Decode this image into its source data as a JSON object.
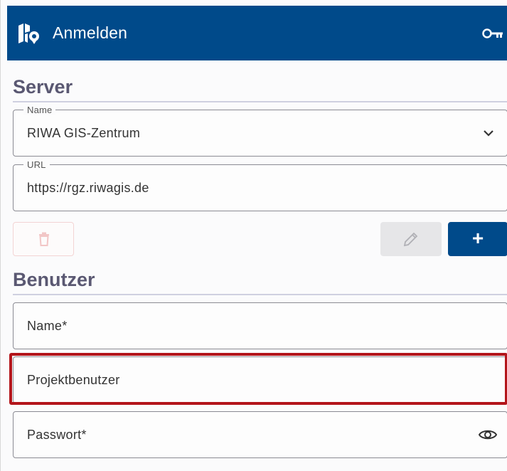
{
  "header": {
    "title": "Anmelden",
    "app_icon": "map-pin-icon",
    "action_icon": "key-icon",
    "background": "#004a8a"
  },
  "server": {
    "section_title": "Server",
    "name_field": {
      "label": "Name",
      "value": "RIWA GIS-Zentrum",
      "icon": "chevron-down-icon"
    },
    "url_field": {
      "label": "URL",
      "value": "https://rgz.riwagis.de"
    },
    "buttons": {
      "delete_icon": "trash-icon",
      "edit_icon": "pencil-icon",
      "add_label": "+"
    }
  },
  "user": {
    "section_title": "Benutzer",
    "name_placeholder": "Name*",
    "project_user_placeholder": "Projektbenutzer",
    "password_placeholder": "Passwort*",
    "password_icon": "eye-icon"
  },
  "colors": {
    "accent": "#004a8a",
    "section_title": "#5a5872",
    "highlight": "#b3151b"
  }
}
